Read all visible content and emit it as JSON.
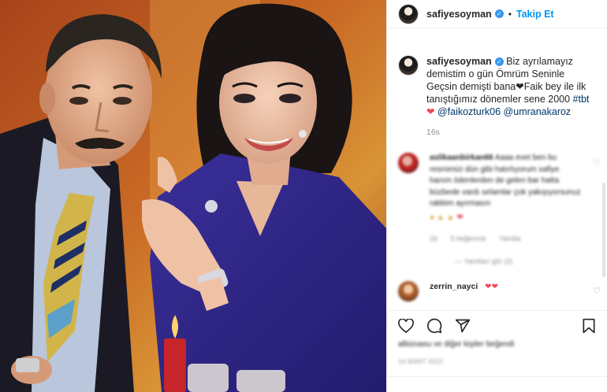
{
  "post": {
    "username": "safiyesoyman",
    "follow_label": "Takip Et",
    "separator": "•",
    "caption_username": "safiyesoyman",
    "caption_text": "Biz ayrılamayız demistim o gün Ömrüm Seninle Geçsin demişti bana",
    "caption_text2": "Faik bey ile ilk tanıştığımız dönemler sene 2000",
    "hashtag": "#tbt",
    "mention1": "@faikozturk06",
    "mention2": "@umranakaroz",
    "time_ago": "16s"
  },
  "comments": [
    {
      "username": "aslikaanbirkan66",
      "text": "Aaaa evet ben bu resmimizi dün gibi hatırlıyorum safiye hanım ödenlerden de gelen bar hatta büzbede vardı selamlar çok yakışıyorsunuz rabbim ayırmasın",
      "meta_likes": "1b",
      "meta_likes_count": "5 beğenme",
      "meta_reply": "Yanıtla",
      "replies_link": "— Yanıtları gör (2)"
    },
    {
      "username": "zerrin_nayci"
    }
  ],
  "footer": {
    "likes_text": "albizoasu ve diğer kişiler beğendi",
    "date_text": "14 MART 2022"
  },
  "colors": {
    "accent": "#0095f6",
    "heart": "#ed4956",
    "verified": "#3897f0"
  },
  "icons": [
    "verified-badge-icon",
    "heart-icon",
    "comment-icon",
    "share-icon",
    "bookmark-icon"
  ]
}
